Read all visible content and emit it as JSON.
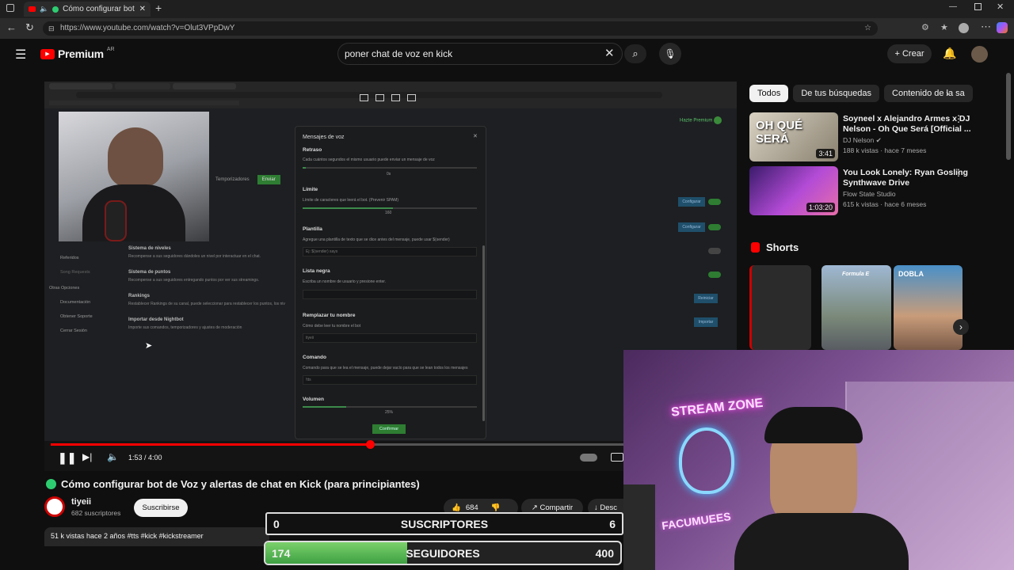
{
  "browser": {
    "tab_title": "Cómo configurar bot de",
    "url": "https://www.youtube.com/watch?v=Olut3VPpDwY"
  },
  "header": {
    "logo": "Premium",
    "region": "AR",
    "search_value": "poner chat de voz en kick",
    "create_label": "Crear"
  },
  "video": {
    "time": "1:53 / 4:00",
    "progress": 0.47,
    "title": "Cómo configurar bot de Voz y alertas de chat en Kick (para principiantes)",
    "channel": "tiyeii",
    "subscribers": "682 suscriptores",
    "subscribe_label": "Suscribirse",
    "likes": "684",
    "share_label": "Compartir",
    "download_label": "Desc",
    "views_meta": "51 k vistas  hace 2 años  #tts #kick #kickstreamer"
  },
  "inner": {
    "modal_title": "Mensajes de voz",
    "sections": [
      {
        "title": "Retraso",
        "desc": "Cada cuántos segundos el mismo usuario puede enviar un mensaje de voz",
        "value": "0s"
      },
      {
        "title": "Límite",
        "desc": "Límite de caracteres que leerá el bot. (Prevenir SPAM)",
        "value": "160"
      },
      {
        "title": "Plantilla",
        "desc": "Agregue una plantilla de texto que se dice antes del mensaje, puede usar $(sender)",
        "value": "Ej: $(sender) says"
      },
      {
        "title": "Lista negra",
        "desc": "Escriba un nombre de usuario y presione enter.",
        "value": ""
      },
      {
        "title": "Remplazar tu nombre",
        "desc": "Cómo debe leer tu nombre el bot",
        "value": "tiyeii"
      },
      {
        "title": "Comando",
        "desc": "Comando para que se lea el mensaje, puede dejar vacío para que se lean todos los mensajes",
        "value": "!tts"
      },
      {
        "title": "Volumen",
        "desc": "",
        "value": "25%"
      }
    ],
    "confirm_label": "Confirmar",
    "premium_label": "Hazte Premium",
    "left_menu": {
      "items": [
        "Sistema de niveles",
        "Sistema de puntos",
        "Rankings",
        "Importar desde Nightbot"
      ],
      "descs": [
        "Recompense a sus seguidores dándoles un nivel por interactuar en el chat.",
        "Recompense a sus seguidores entregando puntos por ver sus streamings.",
        "Restablecer Rankings de su canal, puede seleccionar para restablecer los puntos, los niv",
        "Importe sus comandos, temporizadores y ajustes de moderación"
      ],
      "other_options": "Otras Opciones",
      "links": [
        "Documentación",
        "Obtener Soporte",
        "Cerrar Sesión"
      ],
      "referidos": "Referidos",
      "song_requests": "Song Requests"
    },
    "buttons": [
      "Configurar",
      "Configurar",
      "Reiniciar",
      "Importar"
    ],
    "tabs": [
      "Temporizadores",
      "Enviar"
    ]
  },
  "sidebar": {
    "chips": [
      "Todos",
      "De tus búsquedas",
      "Contenido de la sa"
    ],
    "recs": [
      {
        "title": "Soyneel x Alejandro Armes x DJ Nelson - Oh Que Será [Official ...",
        "channel": "DJ Nelson",
        "meta": "188 k vistas · hace 7 meses",
        "duration": "3:41",
        "thumb_text": "OH QUÉ SERÁ"
      },
      {
        "title": "You Look Lonely: Ryan Gosling Synthwave Drive",
        "channel": "Flow State Studio",
        "meta": "615 k vistas · hace 6 meses",
        "duration": "1:03:20"
      }
    ],
    "shorts_label": "Shorts",
    "short_texts": [
      "Formula E",
      "DOBLA"
    ]
  },
  "overlay": {
    "sub_left": "0",
    "sub_label": "SUSCRIPTORES",
    "sub_right": "6",
    "fol_left": "174",
    "fol_label": "SEGUIDORES",
    "fol_right": "400",
    "fol_fill": 0.4,
    "neon_text1": "STREAM ZONE",
    "neon_text2": "FACUMUEES"
  },
  "colors": {
    "youtube_red": "#ff0000",
    "accent_green": "#2e7d32",
    "overlay_green": "#4caf50"
  }
}
